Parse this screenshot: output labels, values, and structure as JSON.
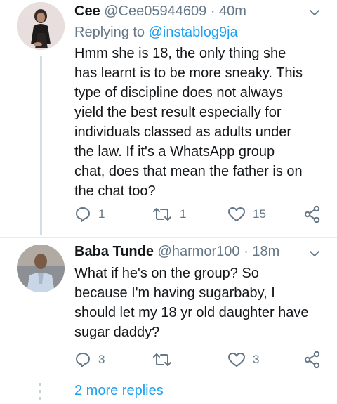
{
  "tweets": [
    {
      "display_name": "Cee",
      "handle": "@Cee05944609",
      "separator": "·",
      "time": "40m",
      "replying_prefix": "Replying to ",
      "replying_to": "@instablog9ja",
      "body_lines": [
        "Hmm she is 18, the only thing she",
        "has learnt is to be more sneaky. This",
        "type of discipline does not always",
        "yield the best result especially for",
        "individuals classed as adults under",
        "the law.  If it's a WhatsApp group",
        "chat, does that mean the father is on",
        "the chat too?"
      ],
      "reply_count": "1",
      "retweet_count": "1",
      "like_count": "15",
      "avatar_icon": "user-avatar-woman"
    },
    {
      "display_name": "Baba Tunde",
      "handle": "@harmor100",
      "separator": "·",
      "time": "18m",
      "body_lines": [
        "What if he's on the group? So",
        "because I'm having sugarbaby, I",
        "should let my 18 yr old daughter have",
        "sugar daddy?"
      ],
      "reply_count": "3",
      "retweet_count": "",
      "like_count": "3",
      "avatar_icon": "user-avatar-man"
    }
  ],
  "more_replies_label": "2 more replies",
  "colors": {
    "link": "#1da1f2",
    "secondary": "#657786",
    "thread_line": "#d3dde6"
  }
}
